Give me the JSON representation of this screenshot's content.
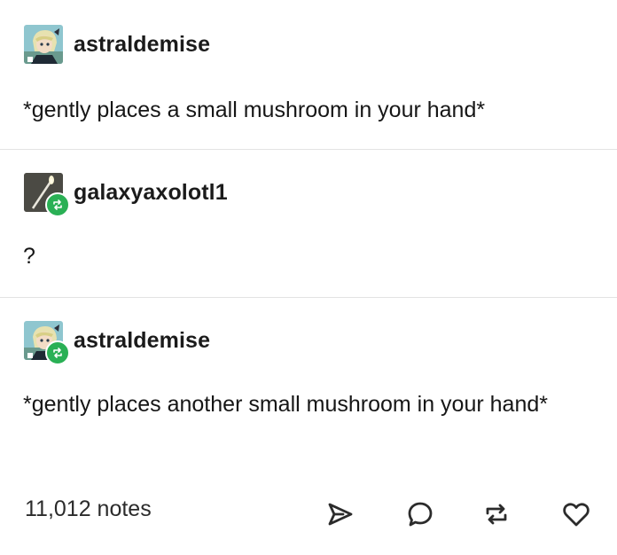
{
  "posts": [
    {
      "username": "astraldemise",
      "avatar": "anime-character-avatar",
      "text": "*gently places a small mushroom in your hand*",
      "reblogged": false
    },
    {
      "username": "galaxyaxolotl1",
      "avatar": "candle-photo-avatar",
      "text": "?",
      "reblogged": true
    },
    {
      "username": "astraldemise",
      "avatar": "anime-character-avatar",
      "text": "*gently places another small mushroom in your hand*",
      "reblogged": true
    }
  ],
  "footer": {
    "notes_label": "11,012 notes",
    "actions": [
      "share-icon",
      "reply-icon",
      "reblog-icon",
      "like-icon"
    ]
  },
  "colors": {
    "reblog_badge": "#2ab055",
    "divider": "#e3e3e3",
    "text": "#161616"
  }
}
